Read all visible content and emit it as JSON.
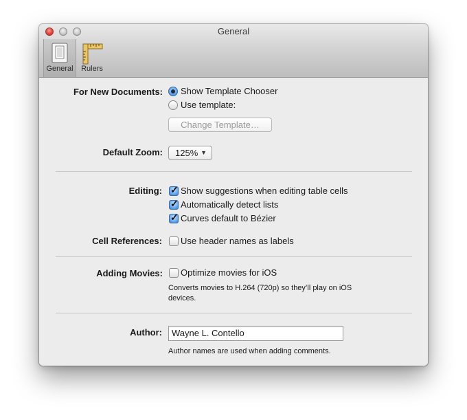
{
  "window": {
    "title": "General"
  },
  "toolbar": {
    "items": [
      {
        "label": "General",
        "icon": "general-icon"
      },
      {
        "label": "Rulers",
        "icon": "rulers-icon"
      }
    ]
  },
  "new_documents": {
    "label": "For New Documents:",
    "option_chooser": "Show Template Chooser",
    "option_template": "Use template:",
    "selected": "Show Template Chooser",
    "change_button": "Change Template…"
  },
  "zoom": {
    "label": "Default Zoom:",
    "value": "125%"
  },
  "editing": {
    "label": "Editing:",
    "options": [
      {
        "label": "Show suggestions when editing table cells",
        "checked": true
      },
      {
        "label": "Automatically detect lists",
        "checked": true
      },
      {
        "label": "Curves default to Bézier",
        "checked": true
      }
    ]
  },
  "cell_references": {
    "label": "Cell References:",
    "option": "Use header names as labels",
    "checked": false
  },
  "movies": {
    "label": "Adding Movies:",
    "option": "Optimize movies for iOS",
    "checked": false,
    "note_line1": "Converts movies to H.264 (720p) so they’ll play on iOS",
    "note_line2": "devices."
  },
  "author": {
    "label": "Author:",
    "value": "Wayne L. Contello",
    "note": "Author names are used when adding comments."
  },
  "colors": {
    "accent": "#4a90e2",
    "window_bg": "#ececec"
  }
}
